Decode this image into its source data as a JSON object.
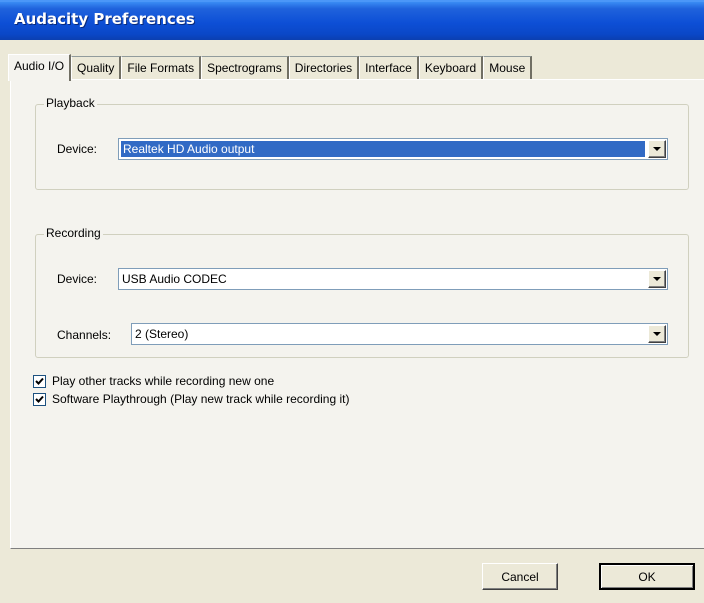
{
  "window": {
    "title": "Audacity Preferences"
  },
  "tabs": [
    {
      "label": "Audio I/O",
      "active": true
    },
    {
      "label": "Quality",
      "active": false
    },
    {
      "label": "File Formats",
      "active": false
    },
    {
      "label": "Spectrograms",
      "active": false
    },
    {
      "label": "Directories",
      "active": false
    },
    {
      "label": "Interface",
      "active": false
    },
    {
      "label": "Keyboard",
      "active": false
    },
    {
      "label": "Mouse",
      "active": false
    }
  ],
  "playback": {
    "group_label": "Playback",
    "device_label": "Device:",
    "device_value": "Realtek HD Audio output"
  },
  "recording": {
    "group_label": "Recording",
    "device_label": "Device:",
    "device_value": "USB Audio CODEC",
    "channels_label": "Channels:",
    "channels_value": "2 (Stereo)"
  },
  "options": [
    {
      "label": "Play other tracks while recording new one",
      "checked": true
    },
    {
      "label": "Software Playthrough (Play new track while recording it)",
      "checked": true
    }
  ],
  "buttons": {
    "cancel": "Cancel",
    "ok": "OK"
  },
  "colors": {
    "titlebar": "#0a47c7",
    "selection": "#316ac5",
    "face": "#ece9d8"
  }
}
